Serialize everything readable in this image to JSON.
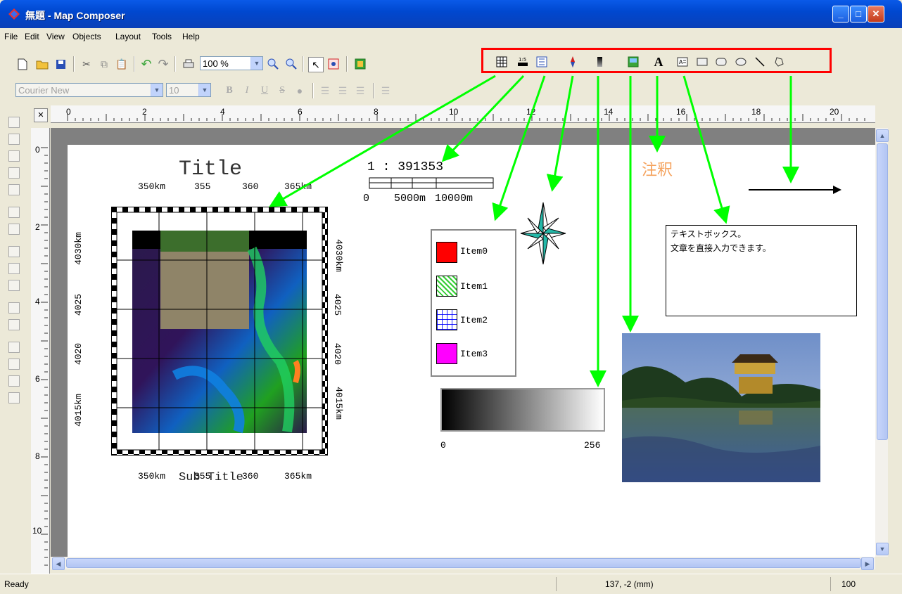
{
  "window": {
    "title": "無題 - Map Composer"
  },
  "menu": [
    "File",
    "Edit",
    "View",
    "Objects",
    "Layout",
    "Tools",
    "Help"
  ],
  "toolbar": {
    "zoom": "100 %",
    "font": "Courier New",
    "font_size": "10"
  },
  "map": {
    "title": "Title",
    "subtitle": "Sub Title",
    "scale_ratio": "1 : 391353",
    "scale_labels": [
      "0",
      "5000m",
      "10000m"
    ],
    "top_ticks": [
      "350km",
      "355",
      "360",
      "365km"
    ],
    "bottom_ticks": [
      "350km",
      "355",
      "360",
      "365km"
    ],
    "left_ticks": [
      "4030km",
      "4025",
      "4020",
      "4015km"
    ],
    "right_ticks": [
      "4030km",
      "4025",
      "4020",
      "4015km"
    ],
    "legend": [
      "Item0",
      "Item1",
      "Item2",
      "Item3"
    ],
    "gradient_min": "0",
    "gradient_max": "256",
    "annotation": "注釈",
    "textbox_line1": "テキストボックス。",
    "textbox_line2": "文章を直接入力できます。"
  },
  "ruler": {
    "h": [
      "0",
      "2",
      "4",
      "6",
      "8",
      "10",
      "12",
      "14",
      "16",
      "18",
      "20"
    ],
    "v": [
      "0",
      "2",
      "4",
      "6",
      "8",
      "10"
    ]
  },
  "status": {
    "left": "Ready",
    "coords": "137, -2 (mm)",
    "zoom": "100"
  },
  "colors": {
    "highlight": "#ff0000",
    "arrow": "#00ff00",
    "annotation": "#f5a25c"
  }
}
